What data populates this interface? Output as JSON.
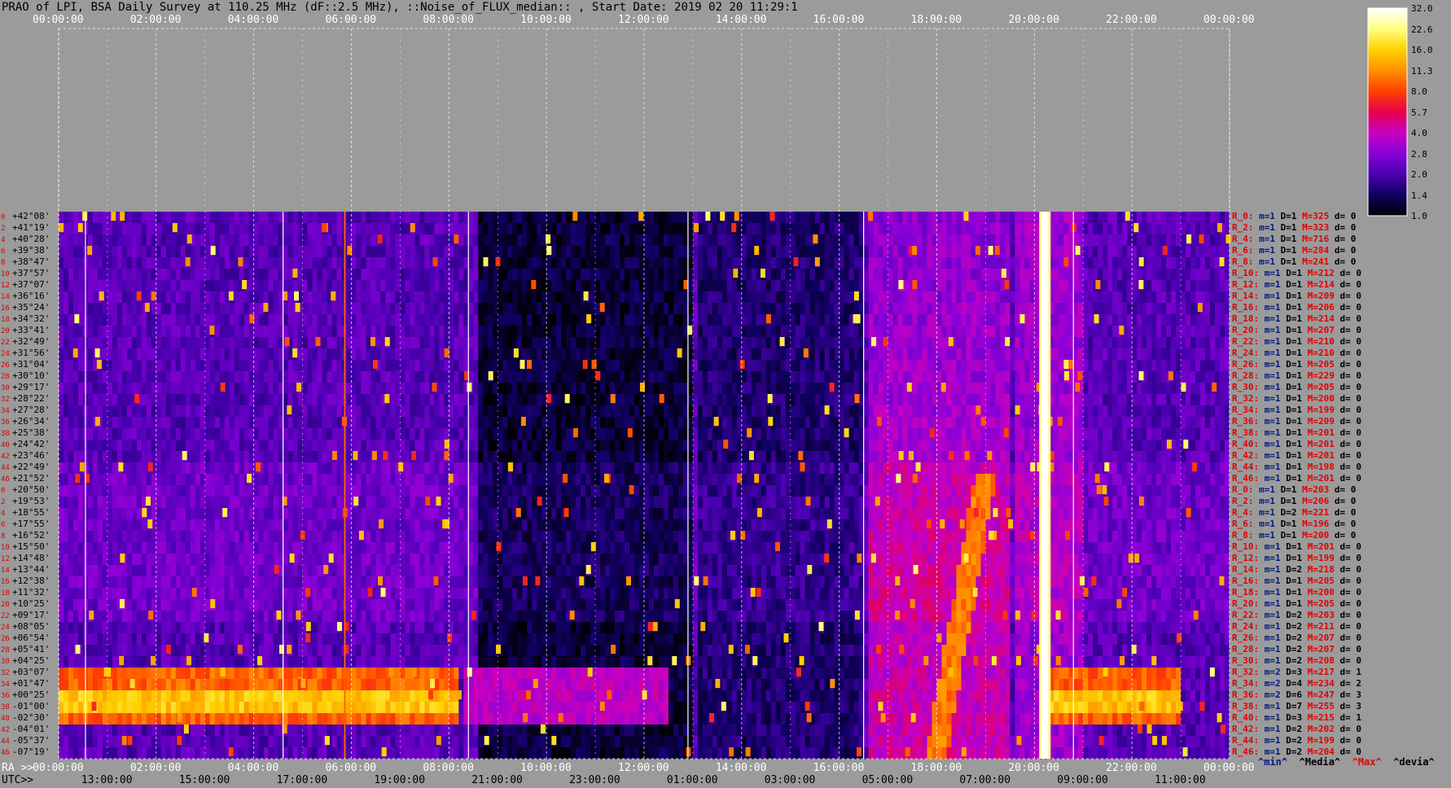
{
  "title": "PRAO of LPI, BSA Daily Survey at 110.25 MHz (dF::2.5 MHz), ::Noise_of_FLUX_median:: , Start Date: 2019 02 20 11:29:1",
  "chart_data": {
    "type": "heatmap",
    "title": "PRAO of LPI, BSA Daily Survey at 110.25 MHz (dF::2.5 MHz), ::Noise_of_FLUX_median:: , Start Date: 2019 02 20 11:29:1",
    "top_axis_ticks": [
      "00:00:00",
      "02:00:00",
      "04:00:00",
      "06:00:00",
      "08:00:00",
      "10:00:00",
      "12:00:00",
      "14:00:00",
      "16:00:00",
      "18:00:00",
      "20:00:00",
      "22:00:00",
      "00:00:00"
    ],
    "bottom_ra_label": "RA >>",
    "bottom_ra_ticks": [
      "00:00:00",
      "02:00:00",
      "04:00:00",
      "06:00:00",
      "08:00:00",
      "10:00:00",
      "12:00:00",
      "14:00:00",
      "16:00:00",
      "18:00:00",
      "20:00:00",
      "22:00:00",
      "00:00:00"
    ],
    "bottom_utc_label": "UTC>>",
    "bottom_utc_ticks": [
      "13:00:00",
      "15:00:00",
      "17:00:00",
      "19:00:00",
      "21:00:00",
      "23:00:00",
      "01:00:00",
      "03:00:00",
      "05:00:00",
      "07:00:00",
      "09:00:00",
      "11:00:00"
    ],
    "declinations": [
      "+42°08'",
      "+41°19'",
      "+40°28'",
      "+39°38'",
      "+38°47'",
      "+37°57'",
      "+37°07'",
      "+36°16'",
      "+35°24'",
      "+34°32'",
      "+33°41'",
      "+32°49'",
      "+31°56'",
      "+31°04'",
      "+30°10'",
      "+29°17'",
      "+28°22'",
      "+27°28'",
      "+26°34'",
      "+25°38'",
      "+24°42'",
      "+23°46'",
      "+22°49'",
      "+21°52'",
      "+20°50'",
      "+19°53'",
      "+18°55'",
      "+17°55'",
      "+16°52'",
      "+15°50'",
      "+14°48'",
      "+13°44'",
      "+12°38'",
      "+11°32'",
      "+10°25'",
      "+09°17'",
      "+08°05'",
      "+06°54'",
      "+05°41'",
      "+04°25'",
      "+03°07'",
      "+01°47'",
      "+00°25'",
      "-01°00'",
      "-02°30'",
      "-04°01'",
      "-05°37'",
      "-07°19'"
    ],
    "row_indices": [
      "0",
      "2",
      "4",
      "6",
      "8",
      "10",
      "12",
      "14",
      "16",
      "18",
      "20",
      "22",
      "24",
      "26",
      "28",
      "30",
      "32",
      "34",
      "36",
      "38",
      "40",
      "42",
      "44",
      "46",
      "0",
      "2",
      "4",
      "6",
      "8",
      "10",
      "12",
      "14",
      "16",
      "18",
      "20",
      "22",
      "24",
      "26",
      "28",
      "30",
      "32",
      "34",
      "36",
      "38",
      "40",
      "42",
      "44",
      "46"
    ],
    "colorbar": {
      "ticks": [
        "32.0",
        "22.6",
        "16.0",
        "11.3",
        "8.0",
        "5.7",
        "4.0",
        "2.8",
        "2.0",
        "1.4",
        "1.0"
      ],
      "scale": "log",
      "range": [
        1.0,
        32.0
      ],
      "colors": [
        "#000000",
        "#100060",
        "#4a00b0",
        "#8800d8",
        "#c800c0",
        "#e8004a",
        "#ff4000",
        "#ff9000",
        "#ffd000",
        "#ffff80",
        "#ffffff"
      ]
    },
    "receivers": [
      {
        "r": "R_0:",
        "m": "m=1",
        "D": "D=1",
        "M": "M=325",
        "d": "d= 0"
      },
      {
        "r": "R_2:",
        "m": "m=1",
        "D": "D=1",
        "M": "M=323",
        "d": "d= 0"
      },
      {
        "r": "R_4:",
        "m": "m=1",
        "D": "D=1",
        "M": "M=716",
        "d": "d= 0"
      },
      {
        "r": "R_6:",
        "m": "m=1",
        "D": "D=1",
        "M": "M=284",
        "d": "d= 0"
      },
      {
        "r": "R_8:",
        "m": "m=1",
        "D": "D=1",
        "M": "M=241",
        "d": "d= 0"
      },
      {
        "r": "R_10:",
        "m": "m=1",
        "D": "D=1",
        "M": "M=212",
        "d": "d= 0"
      },
      {
        "r": "R_12:",
        "m": "m=1",
        "D": "D=1",
        "M": "M=214",
        "d": "d= 0"
      },
      {
        "r": "R_14:",
        "m": "m=1",
        "D": "D=1",
        "M": "M=209",
        "d": "d= 0"
      },
      {
        "r": "R_16:",
        "m": "m=1",
        "D": "D=1",
        "M": "M=206",
        "d": "d= 0"
      },
      {
        "r": "R_18:",
        "m": "m=1",
        "D": "D=1",
        "M": "M=214",
        "d": "d= 0"
      },
      {
        "r": "R_20:",
        "m": "m=1",
        "D": "D=1",
        "M": "M=207",
        "d": "d= 0"
      },
      {
        "r": "R_22:",
        "m": "m=1",
        "D": "D=1",
        "M": "M=210",
        "d": "d= 0"
      },
      {
        "r": "R_24:",
        "m": "m=1",
        "D": "D=1",
        "M": "M=210",
        "d": "d= 0"
      },
      {
        "r": "R_26:",
        "m": "m=1",
        "D": "D=1",
        "M": "M=205",
        "d": "d= 0"
      },
      {
        "r": "R_28:",
        "m": "m=1",
        "D": "D=1",
        "M": "M=229",
        "d": "d= 0"
      },
      {
        "r": "R_30:",
        "m": "m=1",
        "D": "D=1",
        "M": "M=205",
        "d": "d= 0"
      },
      {
        "r": "R_32:",
        "m": "m=1",
        "D": "D=1",
        "M": "M=200",
        "d": "d= 0"
      },
      {
        "r": "R_34:",
        "m": "m=1",
        "D": "D=1",
        "M": "M=199",
        "d": "d= 0"
      },
      {
        "r": "R_36:",
        "m": "m=1",
        "D": "D=1",
        "M": "M=209",
        "d": "d= 0"
      },
      {
        "r": "R_38:",
        "m": "m=1",
        "D": "D=1",
        "M": "M=201",
        "d": "d= 0"
      },
      {
        "r": "R_40:",
        "m": "m=1",
        "D": "D=1",
        "M": "M=201",
        "d": "d= 0"
      },
      {
        "r": "R_42:",
        "m": "m=1",
        "D": "D=1",
        "M": "M=201",
        "d": "d= 0"
      },
      {
        "r": "R_44:",
        "m": "m=1",
        "D": "D=1",
        "M": "M=198",
        "d": "d= 0"
      },
      {
        "r": "R_46:",
        "m": "m=1",
        "D": "D=1",
        "M": "M=201",
        "d": "d= 0"
      },
      {
        "r": "R_0:",
        "m": "m=1",
        "D": "D=1",
        "M": "M=203",
        "d": "d= 0"
      },
      {
        "r": "R_2:",
        "m": "m=1",
        "D": "D=1",
        "M": "M=206",
        "d": "d= 0"
      },
      {
        "r": "R_4:",
        "m": "m=1",
        "D": "D=2",
        "M": "M=221",
        "d": "d= 0"
      },
      {
        "r": "R_6:",
        "m": "m=1",
        "D": "D=1",
        "M": "M=196",
        "d": "d= 0"
      },
      {
        "r": "R_8:",
        "m": "m=1",
        "D": "D=1",
        "M": "M=200",
        "d": "d= 0"
      },
      {
        "r": "R_10:",
        "m": "m=1",
        "D": "D=1",
        "M": "M=201",
        "d": "d= 0"
      },
      {
        "r": "R_12:",
        "m": "m=1",
        "D": "D=1",
        "M": "M=199",
        "d": "d= 0"
      },
      {
        "r": "R_14:",
        "m": "m=1",
        "D": "D=2",
        "M": "M=218",
        "d": "d= 0"
      },
      {
        "r": "R_16:",
        "m": "m=1",
        "D": "D=1",
        "M": "M=205",
        "d": "d= 0"
      },
      {
        "r": "R_18:",
        "m": "m=1",
        "D": "D=1",
        "M": "M=200",
        "d": "d= 0"
      },
      {
        "r": "R_20:",
        "m": "m=1",
        "D": "D=1",
        "M": "M=205",
        "d": "d= 0"
      },
      {
        "r": "R_22:",
        "m": "m=1",
        "D": "D=2",
        "M": "M=203",
        "d": "d= 0"
      },
      {
        "r": "R_24:",
        "m": "m=1",
        "D": "D=2",
        "M": "M=211",
        "d": "d= 0"
      },
      {
        "r": "R_26:",
        "m": "m=1",
        "D": "D=2",
        "M": "M=207",
        "d": "d= 0"
      },
      {
        "r": "R_28:",
        "m": "m=1",
        "D": "D=2",
        "M": "M=207",
        "d": "d= 0"
      },
      {
        "r": "R_30:",
        "m": "m=1",
        "D": "D=2",
        "M": "M=208",
        "d": "d= 0"
      },
      {
        "r": "R_32:",
        "m": "m=2",
        "D": "D=3",
        "M": "M=217",
        "d": "d= 1"
      },
      {
        "r": "R_34:",
        "m": "m=2",
        "D": "D=4",
        "M": "M=234",
        "d": "d= 2"
      },
      {
        "r": "R_36:",
        "m": "m=2",
        "D": "D=6",
        "M": "M=247",
        "d": "d= 3"
      },
      {
        "r": "R_38:",
        "m": "m=1",
        "D": "D=7",
        "M": "M=255",
        "d": "d= 3"
      },
      {
        "r": "R_40:",
        "m": "m=1",
        "D": "D=3",
        "M": "M=215",
        "d": "d= 1"
      },
      {
        "r": "R_42:",
        "m": "m=1",
        "D": "D=2",
        "M": "M=202",
        "d": "d= 0"
      },
      {
        "r": "R_44:",
        "m": "m=1",
        "D": "D=2",
        "M": "M=199",
        "d": "d= 0"
      },
      {
        "r": "R_46:",
        "m": "m=1",
        "D": "D=2",
        "M": "M=204",
        "d": "d= 0"
      }
    ],
    "legend": {
      "min": "^min^",
      "media": "^Media^",
      "max": "^Max^",
      "devia": "^devia^"
    },
    "bright_features": [
      {
        "ra_hours": 20.2,
        "description_hidden": true
      },
      {
        "ra_hours": 5.8
      }
    ]
  }
}
